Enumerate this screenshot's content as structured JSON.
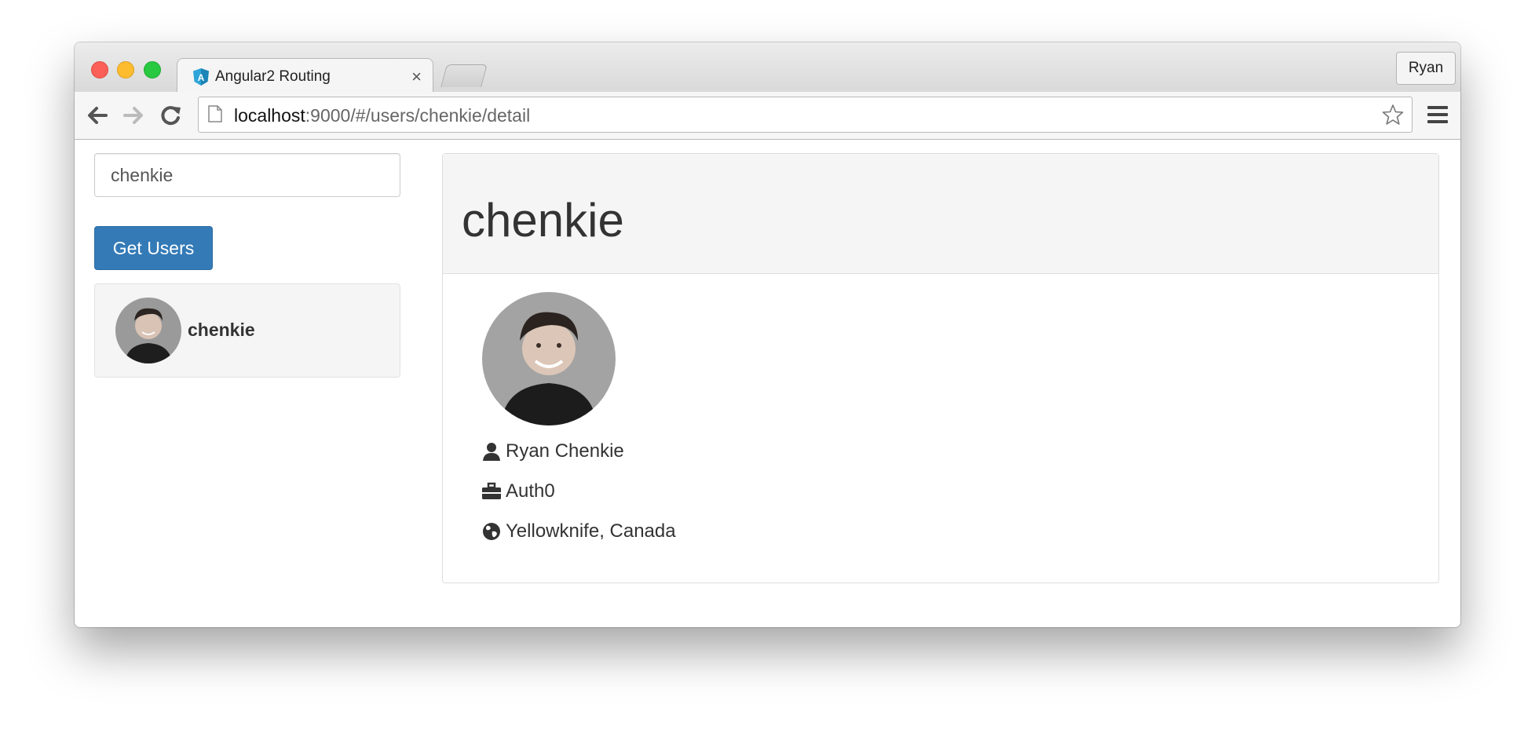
{
  "browser": {
    "tab_title": "Angular2 Routing",
    "tab_close": "×",
    "profile_name": "Ryan",
    "url_host": "localhost",
    "url_path": ":9000/#/users/chenkie/detail"
  },
  "sidebar": {
    "search_value": "chenkie",
    "get_users_label": "Get Users",
    "users": [
      {
        "username": "chenkie"
      }
    ]
  },
  "detail": {
    "username": "chenkie",
    "name": "Ryan Chenkie",
    "company": "Auth0",
    "location": "Yellowknife, Canada"
  },
  "colors": {
    "primary_button": "#337ab7",
    "panel_heading": "#f5f5f5"
  },
  "icons": [
    "user-icon",
    "briefcase-icon",
    "globe-icon",
    "star-icon",
    "menu-icon",
    "reload-icon",
    "back-icon",
    "forward-icon",
    "page-icon",
    "angular-favicon"
  ]
}
